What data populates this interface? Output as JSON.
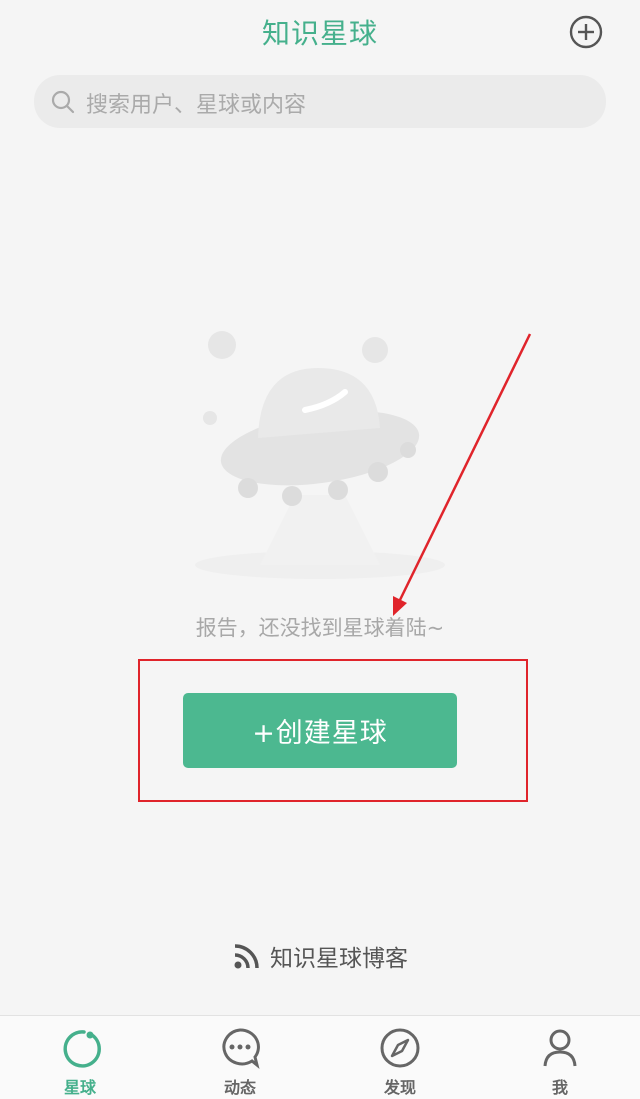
{
  "header": {
    "title": "知识星球"
  },
  "search": {
    "placeholder": "搜索用户、星球或内容"
  },
  "empty_state": {
    "message": "报告，还没找到星球着陆~"
  },
  "create": {
    "label": "+创建星球"
  },
  "blog": {
    "label": "知识星球博客"
  },
  "tabs": [
    {
      "label": "星球",
      "icon": "planet-icon",
      "active": true
    },
    {
      "label": "动态",
      "icon": "chat-bubble-icon",
      "active": false
    },
    {
      "label": "发现",
      "icon": "compass-icon",
      "active": false
    },
    {
      "label": "我",
      "icon": "person-icon",
      "active": false
    }
  ],
  "colors": {
    "accent": "#45b08c",
    "button": "#4cb890",
    "annotation": "#e0242b"
  }
}
